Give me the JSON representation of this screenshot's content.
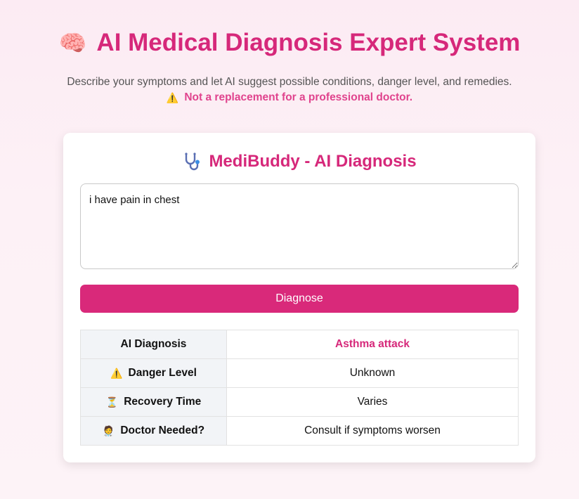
{
  "header": {
    "title_icon": "🧠",
    "title": "AI Medical Diagnosis Expert System",
    "subtitle": "Describe your symptoms and let AI suggest possible conditions, danger level, and remedies.",
    "warning_icon": "⚠️",
    "warning": "Not a replacement for a professional doctor."
  },
  "card": {
    "title_icon": "stethoscope-icon",
    "title": "MediBuddy - AI Diagnosis",
    "symptoms_value": "i have pain in chest",
    "diagnose_label": "Diagnose"
  },
  "results": {
    "rows": [
      {
        "icon": "",
        "label": "AI Diagnosis",
        "value": "Asthma attack"
      },
      {
        "icon": "⚠️",
        "label": "Danger Level",
        "value": "Unknown"
      },
      {
        "icon": "⏳",
        "label": "Recovery Time",
        "value": "Varies"
      },
      {
        "icon": "🧑‍⚕️",
        "label": "Doctor Needed?",
        "value": "Consult if symptoms worsen"
      }
    ]
  },
  "colors": {
    "accent": "#d6287a",
    "button": "#d9297a",
    "warning_text": "#e0438d",
    "label_bg": "#f2f4f7"
  }
}
